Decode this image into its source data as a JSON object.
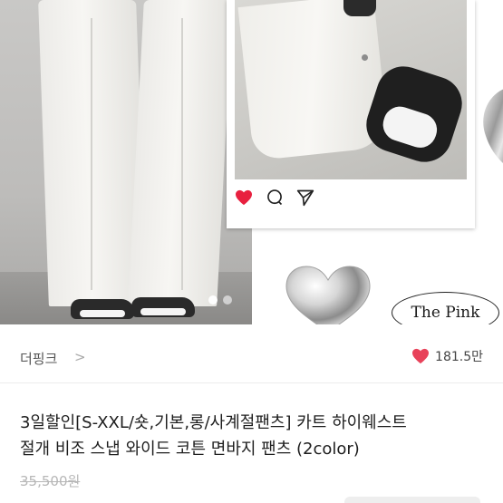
{
  "gallery": {
    "dots": [
      true,
      false
    ],
    "logo_text": "The Pink"
  },
  "shop": {
    "name": "더핑크",
    "chevron": ">",
    "like_count": "181.5만",
    "like_color": "#e8425a"
  },
  "product": {
    "title_line1": "3일할인[S-XXL/숏,기본,롱/사계절팬츠] 카트 하이웨스트",
    "title_line2": "절개 비조 스냅 와이드 코튼 면바지 팬츠 (2color)",
    "original_price": "35,500원"
  },
  "colors": {
    "heart_red": "#e8425a",
    "text": "#1e1e1e",
    "muted": "#b7b7b7"
  }
}
